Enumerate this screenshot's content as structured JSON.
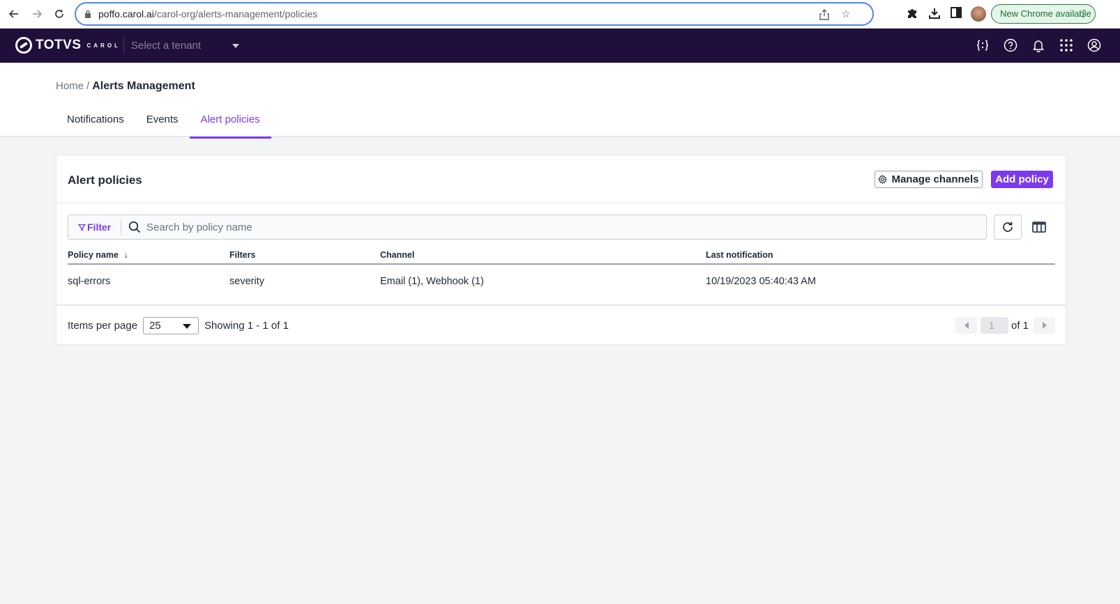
{
  "browser": {
    "url_domain": "poffo.carol.ai",
    "url_path": "/carol-org/alerts-management/policies",
    "new_chrome_label": "New Chrome available",
    "icons": [
      "back-icon",
      "forward-icon",
      "reload-icon",
      "lock-icon",
      "share-icon",
      "bookmark-star-icon",
      "extensions-icon",
      "download-icon",
      "side-panel-icon",
      "profile-avatar",
      "more-vert-icon"
    ]
  },
  "header": {
    "logo_text": "TOTVS",
    "logo_sub": "CAROL",
    "tenant_placeholder": "Select a tenant",
    "icons": [
      "api-braces-icon",
      "help-icon",
      "notification-bell-icon",
      "apps-grid-icon",
      "user-account-icon"
    ]
  },
  "breadcrumb": {
    "home": "Home",
    "separator": "/",
    "current": "Alerts Management"
  },
  "tabs": [
    {
      "label": "Notifications",
      "active": false
    },
    {
      "label": "Events",
      "active": false
    },
    {
      "label": "Alert policies",
      "active": true
    }
  ],
  "card": {
    "title": "Alert policies",
    "manage_channels_label": "Manage channels",
    "add_policy_label": "Add policy",
    "filter_label": "Filter",
    "search_placeholder": "Search by policy name",
    "search_value": ""
  },
  "table": {
    "columns": [
      {
        "label": "Policy name",
        "sort": "desc"
      },
      {
        "label": "Filters"
      },
      {
        "label": "Channel"
      },
      {
        "label": "Last notification"
      }
    ],
    "sort_indicator": "↓",
    "rows": [
      [
        "sql-errors",
        "severity",
        "Email (1), Webhook (1)",
        "10/19/2023 05:40:43 AM"
      ]
    ]
  },
  "pagination": {
    "items_per_page_label": "Items per page",
    "items_per_page_value": "25",
    "showing_text": "Showing 1 - 1 of 1",
    "current_page": "1",
    "of_text": "of 1"
  },
  "colors": {
    "accent": "#7c3aed",
    "header_bg": "#1f0f3a",
    "page_bg": "#f3f4f6"
  }
}
